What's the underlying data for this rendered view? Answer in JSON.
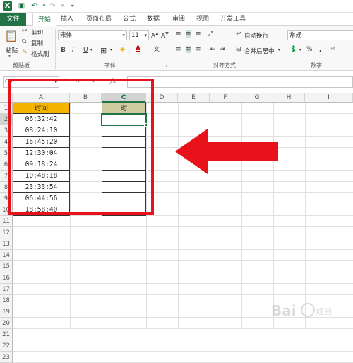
{
  "quick_access": {
    "icons": [
      "excel-logo-icon",
      "save-icon",
      "undo-icon",
      "redo-icon"
    ]
  },
  "tabs": [
    {
      "label": "文件",
      "name": "file"
    },
    {
      "label": "开始",
      "name": "home"
    },
    {
      "label": "插入",
      "name": "insert"
    },
    {
      "label": "页面布局",
      "name": "page-layout"
    },
    {
      "label": "公式",
      "name": "formulas"
    },
    {
      "label": "数据",
      "name": "data"
    },
    {
      "label": "审阅",
      "name": "review"
    },
    {
      "label": "视图",
      "name": "view"
    },
    {
      "label": "开发工具",
      "name": "developer"
    }
  ],
  "ribbon": {
    "clipboard": {
      "paste": "粘贴",
      "cut": "剪切",
      "copy": "复制",
      "format_painter": "格式刷",
      "group": "剪贴板"
    },
    "font": {
      "name": "宋体",
      "size": "11",
      "group": "字体",
      "bold": "B",
      "italic": "I",
      "underline": "U"
    },
    "alignment": {
      "wrap": "自动换行",
      "merge": "合并后居中",
      "group": "对齐方式"
    },
    "number": {
      "format": "常规",
      "group": "数字",
      "percent": "%",
      "comma": ","
    }
  },
  "formula_bar": {
    "namebox": "C2",
    "fx": "fx",
    "cancel": "✕",
    "enter": "✓"
  },
  "columns": [
    "A",
    "B",
    "C",
    "D",
    "E",
    "F",
    "G",
    "H",
    "I"
  ],
  "rows": [
    "1",
    "2",
    "3",
    "4",
    "5",
    "6",
    "7",
    "8",
    "9",
    "10",
    "11",
    "12",
    "13",
    "14",
    "15",
    "16",
    "17",
    "18",
    "19",
    "20",
    "21",
    "22",
    "23"
  ],
  "sheet": {
    "A1": "时间",
    "C1": "时",
    "times": [
      "06:32:42",
      "08:24:10",
      "16:45:20",
      "12:30:04",
      "09:18:24",
      "10:48:18",
      "23:33:54",
      "06:44:56",
      "18:58:40"
    ]
  },
  "colors": {
    "accent": "#217346",
    "header_fill": "#f4b400",
    "c_header_fill": "#d0cba0",
    "annotation": "#e8131a"
  }
}
